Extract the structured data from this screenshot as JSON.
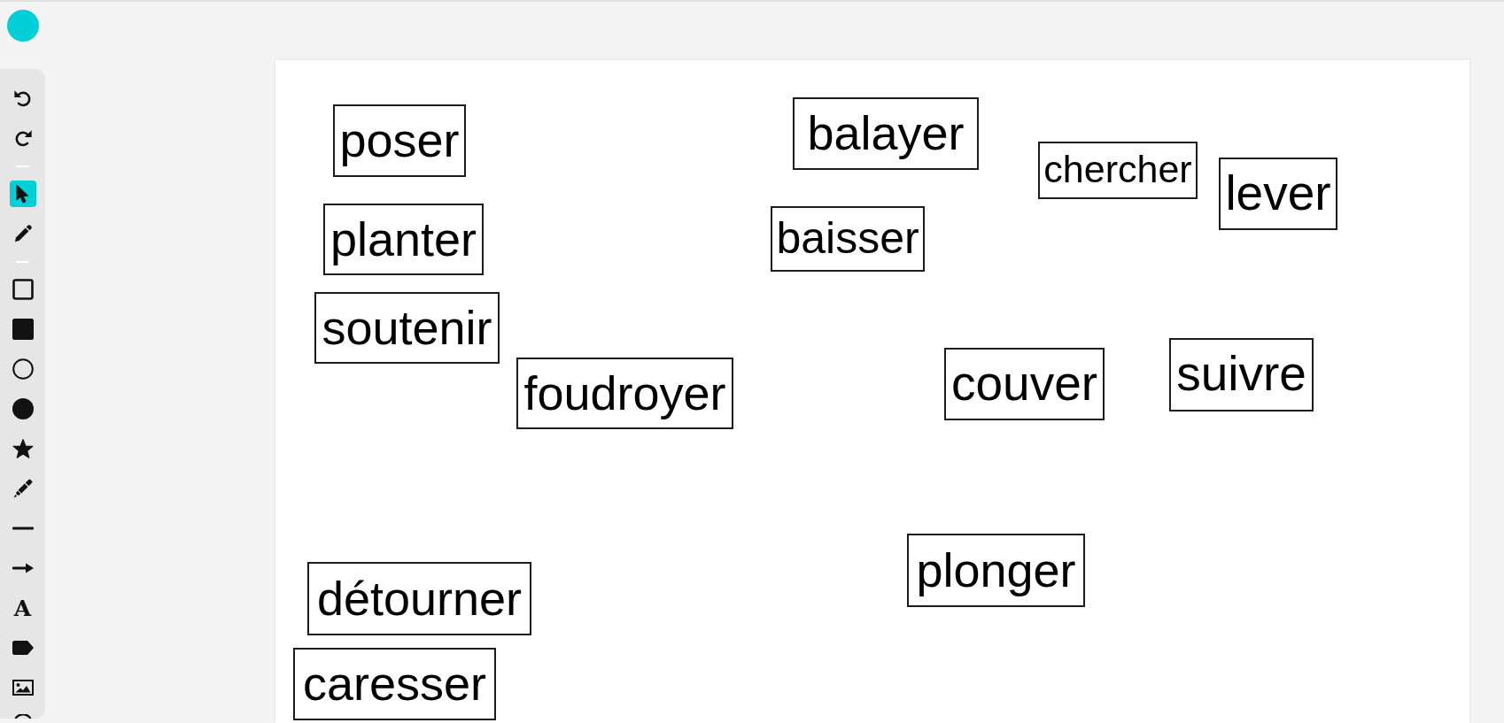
{
  "toolbar": {
    "groups": [
      {
        "tools": [
          {
            "kind": "undo",
            "selected": false
          },
          {
            "kind": "redo",
            "selected": false
          }
        ]
      },
      {
        "tools": [
          {
            "kind": "select",
            "selected": true
          },
          {
            "kind": "pencil",
            "selected": false
          }
        ]
      },
      {
        "tools": [
          {
            "kind": "rectangle",
            "selected": false
          },
          {
            "kind": "filled_rectangle",
            "selected": false
          },
          {
            "kind": "circle",
            "selected": false
          },
          {
            "kind": "filled_circle",
            "selected": false
          },
          {
            "kind": "star",
            "selected": false
          },
          {
            "kind": "highlighter",
            "selected": false
          },
          {
            "kind": "line",
            "selected": false
          },
          {
            "kind": "arrow",
            "selected": false
          },
          {
            "kind": "text",
            "glyph": "A",
            "selected": false
          },
          {
            "kind": "label",
            "selected": false
          },
          {
            "kind": "image",
            "selected": false
          },
          {
            "kind": "cut_off",
            "selected": false
          }
        ]
      }
    ]
  },
  "canvas": {
    "words": [
      {
        "text": "poser"
      },
      {
        "text": "balayer"
      },
      {
        "text": "chercher"
      },
      {
        "text": "lever"
      },
      {
        "text": "planter"
      },
      {
        "text": "baisser"
      },
      {
        "text": "soutenir"
      },
      {
        "text": "foudroyer"
      },
      {
        "text": "couver"
      },
      {
        "text": "suivre"
      },
      {
        "text": "plonger"
      },
      {
        "text": "détourner"
      },
      {
        "text": "caresser"
      }
    ]
  }
}
